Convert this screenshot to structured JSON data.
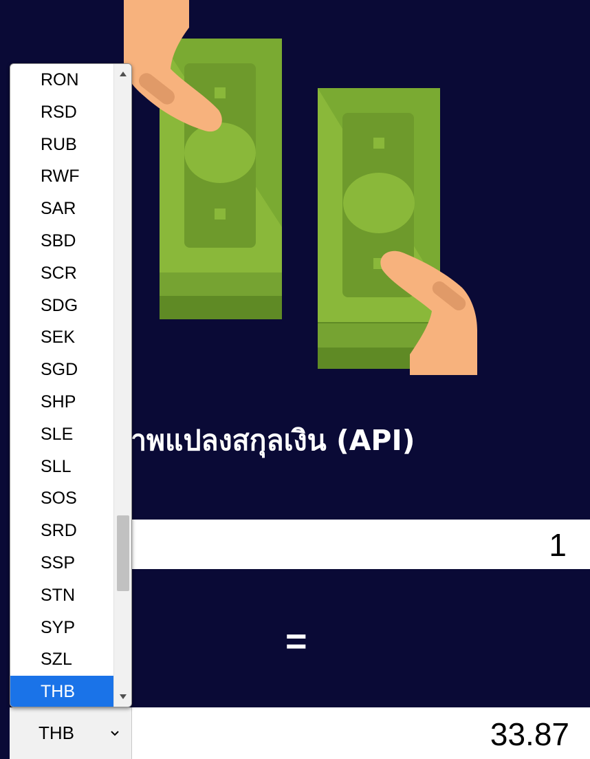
{
  "title": "ตัวแปลงสกุลเงิน (API)",
  "title_visible": "าพแปลงสกุลเงิน (API)",
  "amount": {
    "value": "1"
  },
  "equals": "=",
  "result": {
    "currency": "THB",
    "value": "33.87"
  },
  "dropdown": {
    "options": [
      "RON",
      "RSD",
      "RUB",
      "RWF",
      "SAR",
      "SBD",
      "SCR",
      "SDG",
      "SEK",
      "SGD",
      "SHP",
      "SLE",
      "SLL",
      "SOS",
      "SRD",
      "SSP",
      "STN",
      "SYP",
      "SZL",
      "THB"
    ],
    "selected": "THB",
    "highlight_color": "#1a73e8"
  },
  "colors": {
    "background": "#0a0a36",
    "money_green": "#8ab83a",
    "money_dark": "#6f9a2c",
    "hand": "#f7b27d"
  },
  "icons": [
    "money-exchange-illustration",
    "chevron-down-icon",
    "scroll-up-arrow-icon",
    "scroll-down-arrow-icon"
  ]
}
